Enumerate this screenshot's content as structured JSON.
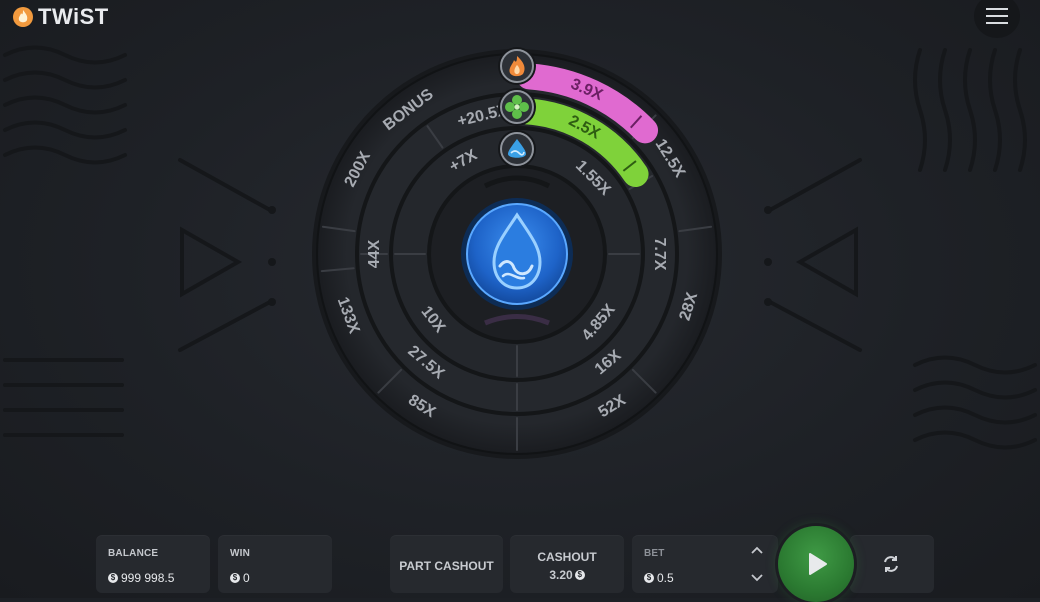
{
  "app": {
    "title": "TWiST"
  },
  "wheel": {
    "outer": [
      "BONUS",
      "12.5X",
      "28X",
      "52X",
      "85X",
      "133X",
      "200X"
    ],
    "middle": [
      "+20.5X",
      "7.7X",
      "16X",
      "27.5X",
      "44X"
    ],
    "inner": [
      "+7X",
      "1.55X",
      "4.85X",
      "10X"
    ],
    "progress_bars": [
      {
        "label": "3.9X",
        "color": "#e06ad0",
        "text_color": "#6b1f63"
      },
      {
        "label": "2.5X",
        "color": "#7fd23a",
        "text_color": "#2e5d12"
      }
    ],
    "markers": [
      {
        "icon": "fire-icon",
        "color": "#f08a3a"
      },
      {
        "icon": "leaf-icon",
        "color": "#5fbf4a"
      },
      {
        "icon": "water-drop-icon",
        "color": "#3aa0e6"
      }
    ],
    "center_icon": "water-wave-icon",
    "center_color": "#1f6fd0"
  },
  "bottom_bar": {
    "balance": {
      "label": "BALANCE",
      "value": "999 998.5"
    },
    "win": {
      "label": "WIN",
      "value": "0"
    },
    "part_cashout": {
      "label": "PART CASHOUT"
    },
    "cashout": {
      "label": "CASHOUT",
      "value": "3.20"
    },
    "bet": {
      "label": "BET",
      "value": "0.5"
    },
    "play_icon": "play-icon",
    "autoplay_icon": "refresh-icon",
    "currency_symbol": "$"
  }
}
